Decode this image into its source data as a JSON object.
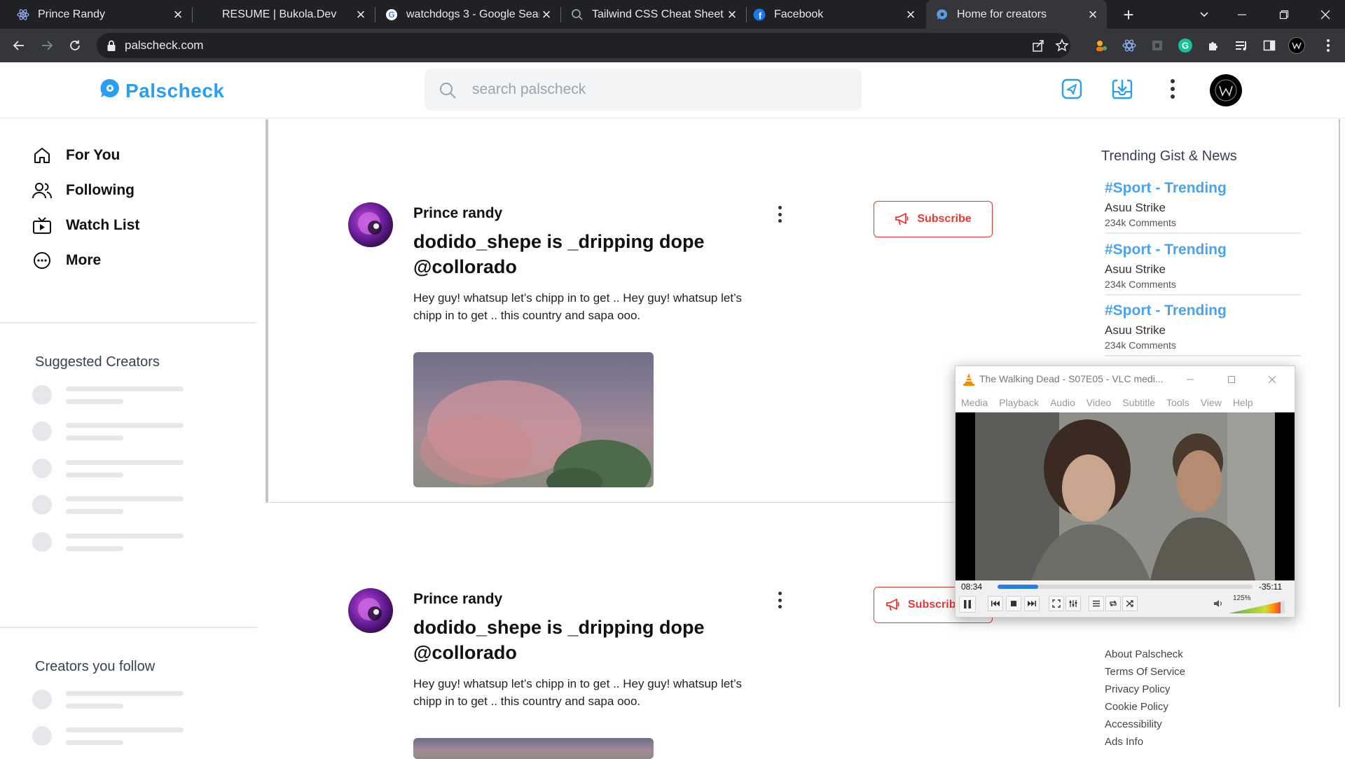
{
  "browser": {
    "tabs": [
      {
        "label": "Prince Randy",
        "favicon": "react-icon",
        "active": false
      },
      {
        "label": "RESUME | Bukola.Dev",
        "favicon": "none",
        "active": false
      },
      {
        "label": "watchdogs 3 - Google Sear",
        "favicon": "google-icon",
        "active": false
      },
      {
        "label": "Tailwind CSS Cheat Sheet",
        "favicon": "search-icon",
        "active": false
      },
      {
        "label": "Facebook",
        "favicon": "facebook-icon",
        "active": false
      },
      {
        "label": "Home for creators",
        "favicon": "palscheck-icon",
        "active": true
      }
    ],
    "url": "palscheck.com"
  },
  "site": {
    "logo_text": "Palscheck",
    "brand_color": "#2a9df4",
    "search_placeholder": "search palscheck"
  },
  "sidebar": {
    "nav": [
      {
        "label": "For You",
        "icon": "home-icon"
      },
      {
        "label": "Following",
        "icon": "users-icon"
      },
      {
        "label": "Watch List",
        "icon": "tv-icon"
      },
      {
        "label": "More",
        "icon": "more-circle-icon"
      }
    ],
    "suggested_title": "Suggested Creators",
    "following_title": "Creators you follow"
  },
  "posts": [
    {
      "author": "Prince randy",
      "title": "dodido_shepe is _dripping dope @collorado",
      "body": "Hey guy! whatsup let’s chipp in to get .. Hey guy! whatsup let’s chipp in to get .. this country and sapa ooo.",
      "subscribe_label": "Subscribe"
    },
    {
      "author": "Prince randy",
      "title": "dodido_shepe is _dripping dope @collorado",
      "body": "Hey guy! whatsup let’s chipp in to get .. Hey guy! whatsup let’s chipp in to get .. this country and sapa ooo.",
      "subscribe_label": "Subscrib"
    }
  ],
  "trending": {
    "title": "Trending Gist & News",
    "items": [
      {
        "tag": "#Sport - Trending",
        "name": "Asuu Strike",
        "comments": "234k Comments"
      },
      {
        "tag": "#Sport - Trending",
        "name": "Asuu Strike",
        "comments": "234k Comments"
      },
      {
        "tag": "#Sport - Trending",
        "name": "Asuu Strike",
        "comments": "234k Comments"
      }
    ]
  },
  "footer": {
    "links": [
      "About Palscheck",
      "Terms Of Service",
      "Privacy Policy",
      "Cookie Policy",
      "Accessibility",
      "Ads Info"
    ]
  },
  "vlc": {
    "title": "The Walking Dead - S07E05 - VLC medi...",
    "menu": [
      "Media",
      "Playback",
      "Audio",
      "Video",
      "Subtitle",
      "Tools",
      "View",
      "Help"
    ],
    "elapsed": "08:34",
    "remaining": "-35:11",
    "progress": 0.16,
    "volume": "125%"
  }
}
